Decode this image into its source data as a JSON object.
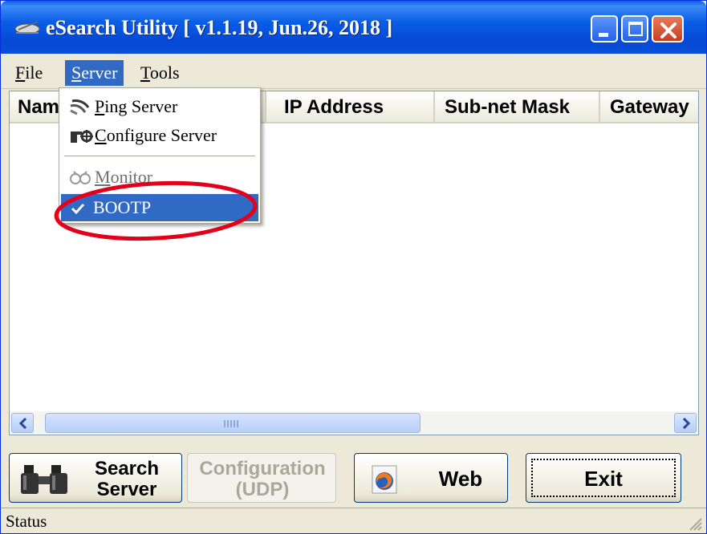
{
  "window": {
    "title": "eSearch Utility [ v1.1.19, Jun.26, 2018 ]",
    "icons": {
      "app": "satellite-dish-icon",
      "minimize": "minimize-icon",
      "maximize": "maximize-icon",
      "close": "close-icon"
    }
  },
  "menubar": {
    "file": {
      "mnemonic": "F",
      "rest": "ile"
    },
    "server": {
      "mnemonic": "S",
      "rest": "erver"
    },
    "tools": {
      "mnemonic": "T",
      "rest": "ools"
    }
  },
  "server_menu": {
    "ping": {
      "mnemonic": "P",
      "rest": "ing Server",
      "icon": "ping-icon"
    },
    "configure": {
      "mnemonic": "C",
      "rest": "onfigure Server",
      "icon": "configure-icon"
    },
    "monitor": {
      "mnemonic": "M",
      "rest": "onitor",
      "icon": "monitor-icon",
      "disabled": true
    },
    "bootp": {
      "label": "BOOTP",
      "checked": true,
      "icon": "check-icon"
    }
  },
  "listview": {
    "columns": [
      "Name",
      "IP Address",
      "Sub-net Mask",
      "Gateway"
    ],
    "rows": []
  },
  "buttons": {
    "search": {
      "line1": "Search",
      "line2": "Server",
      "icon": "binoculars-icon"
    },
    "configuration": {
      "line1": "Configuration",
      "line2": "(UDP)",
      "disabled": true
    },
    "web": {
      "label": "Web",
      "icon": "firefox-icon"
    },
    "exit": {
      "label": "Exit"
    }
  },
  "statusbar": {
    "text": "Status"
  },
  "colors": {
    "titlebar": "#0a5ee6",
    "selection": "#316ac5",
    "annotation_ring": "#e3001b",
    "window_face": "#ece9d8"
  }
}
